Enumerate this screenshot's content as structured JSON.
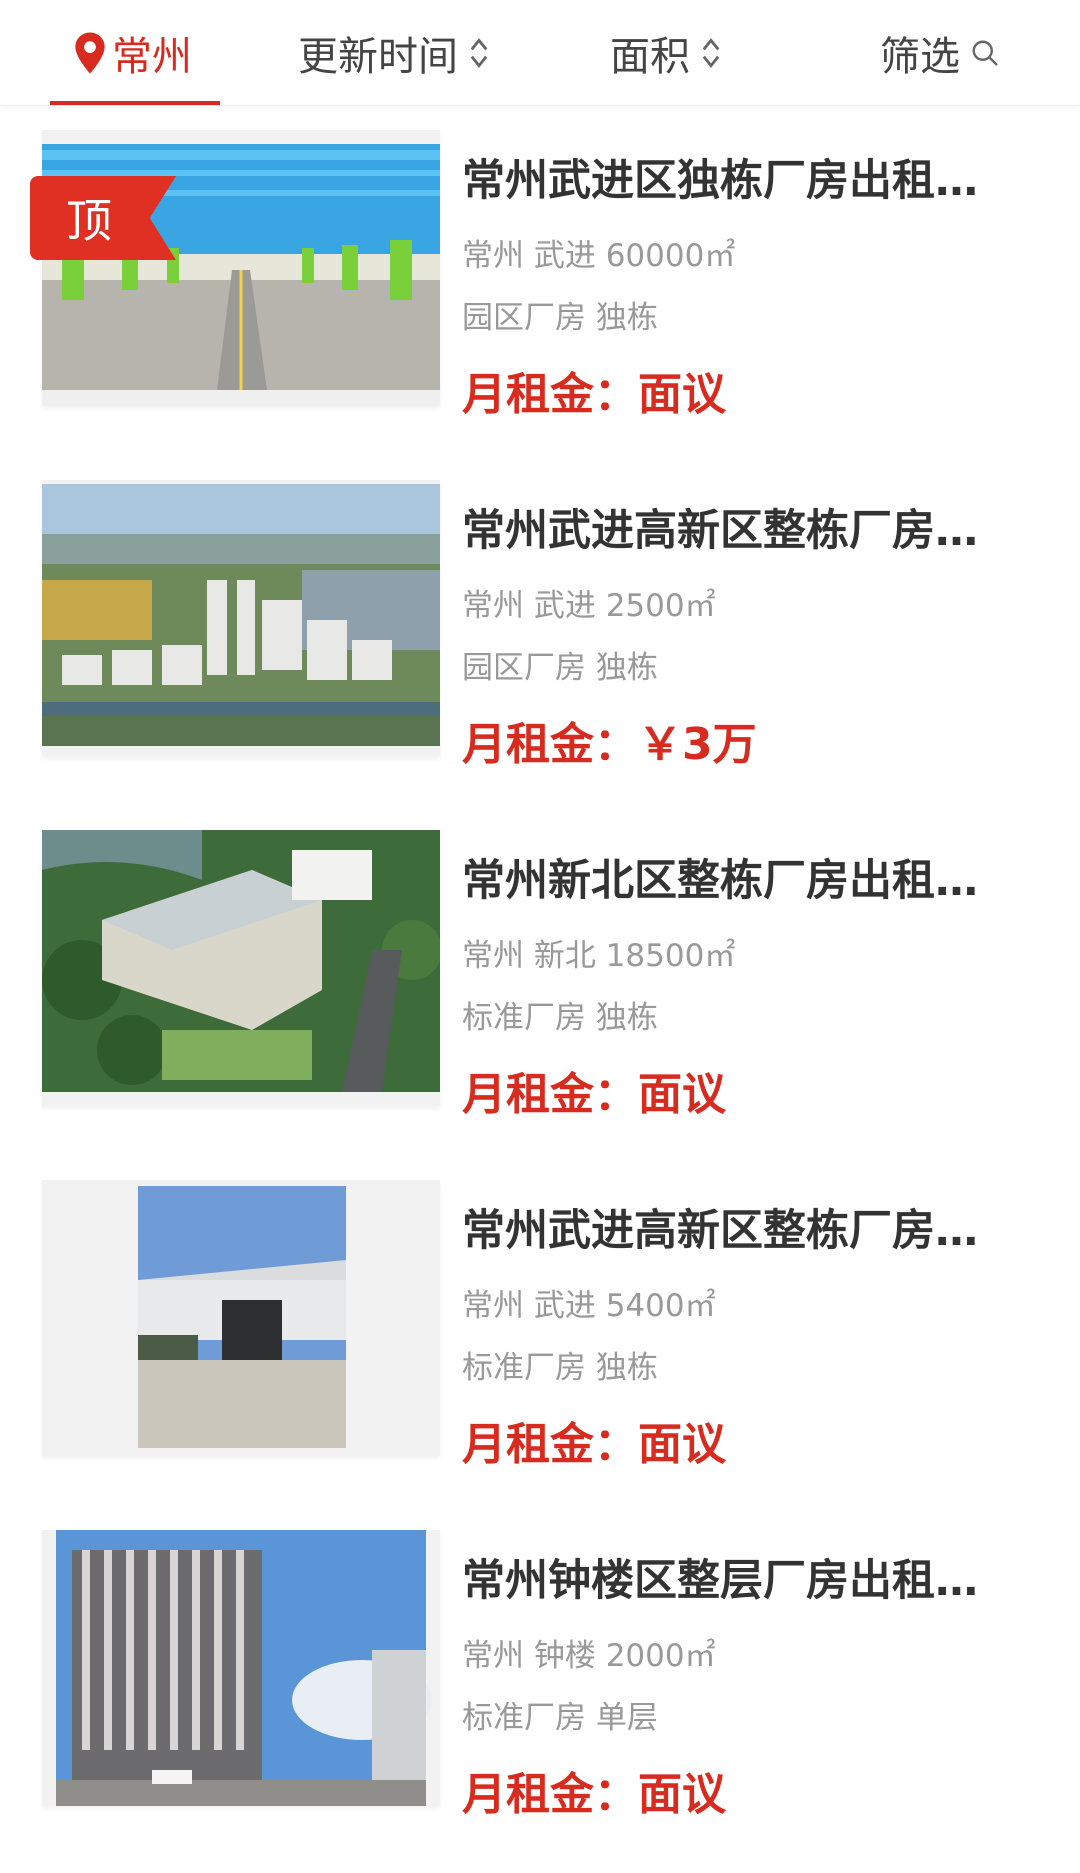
{
  "header": {
    "city": "常州",
    "sort_time": "更新时间",
    "sort_area": "面积",
    "filter": "筛选"
  },
  "listings": [
    {
      "title": "常州武进区独栋厂房出租…",
      "location": "常州 武进 60000㎡",
      "type": "园区厂房 独栋",
      "price": "月租金：面议",
      "badge": "顶"
    },
    {
      "title": "常州武进高新区整栋厂房…",
      "location": "常州 武进 2500㎡",
      "type": "园区厂房 独栋",
      "price": "月租金：￥3万"
    },
    {
      "title": "常州新北区整栋厂房出租…",
      "location": "常州 新北 18500㎡",
      "type": "标准厂房 独栋",
      "price": "月租金：面议"
    },
    {
      "title": "常州武进高新区整栋厂房…",
      "location": "常州 武进 5400㎡",
      "type": "标准厂房 独栋",
      "price": "月租金：面议"
    },
    {
      "title": "常州钟楼区整层厂房出租…",
      "location": "常州 钟楼 2000㎡",
      "type": "标准厂房 单层",
      "price": "月租金：面议"
    }
  ],
  "colors": {
    "accent": "#d62b1e",
    "title": "#333333",
    "meta": "#999999"
  },
  "icons": [
    "location-pin-icon",
    "sort-arrows-icon",
    "search-icon"
  ]
}
